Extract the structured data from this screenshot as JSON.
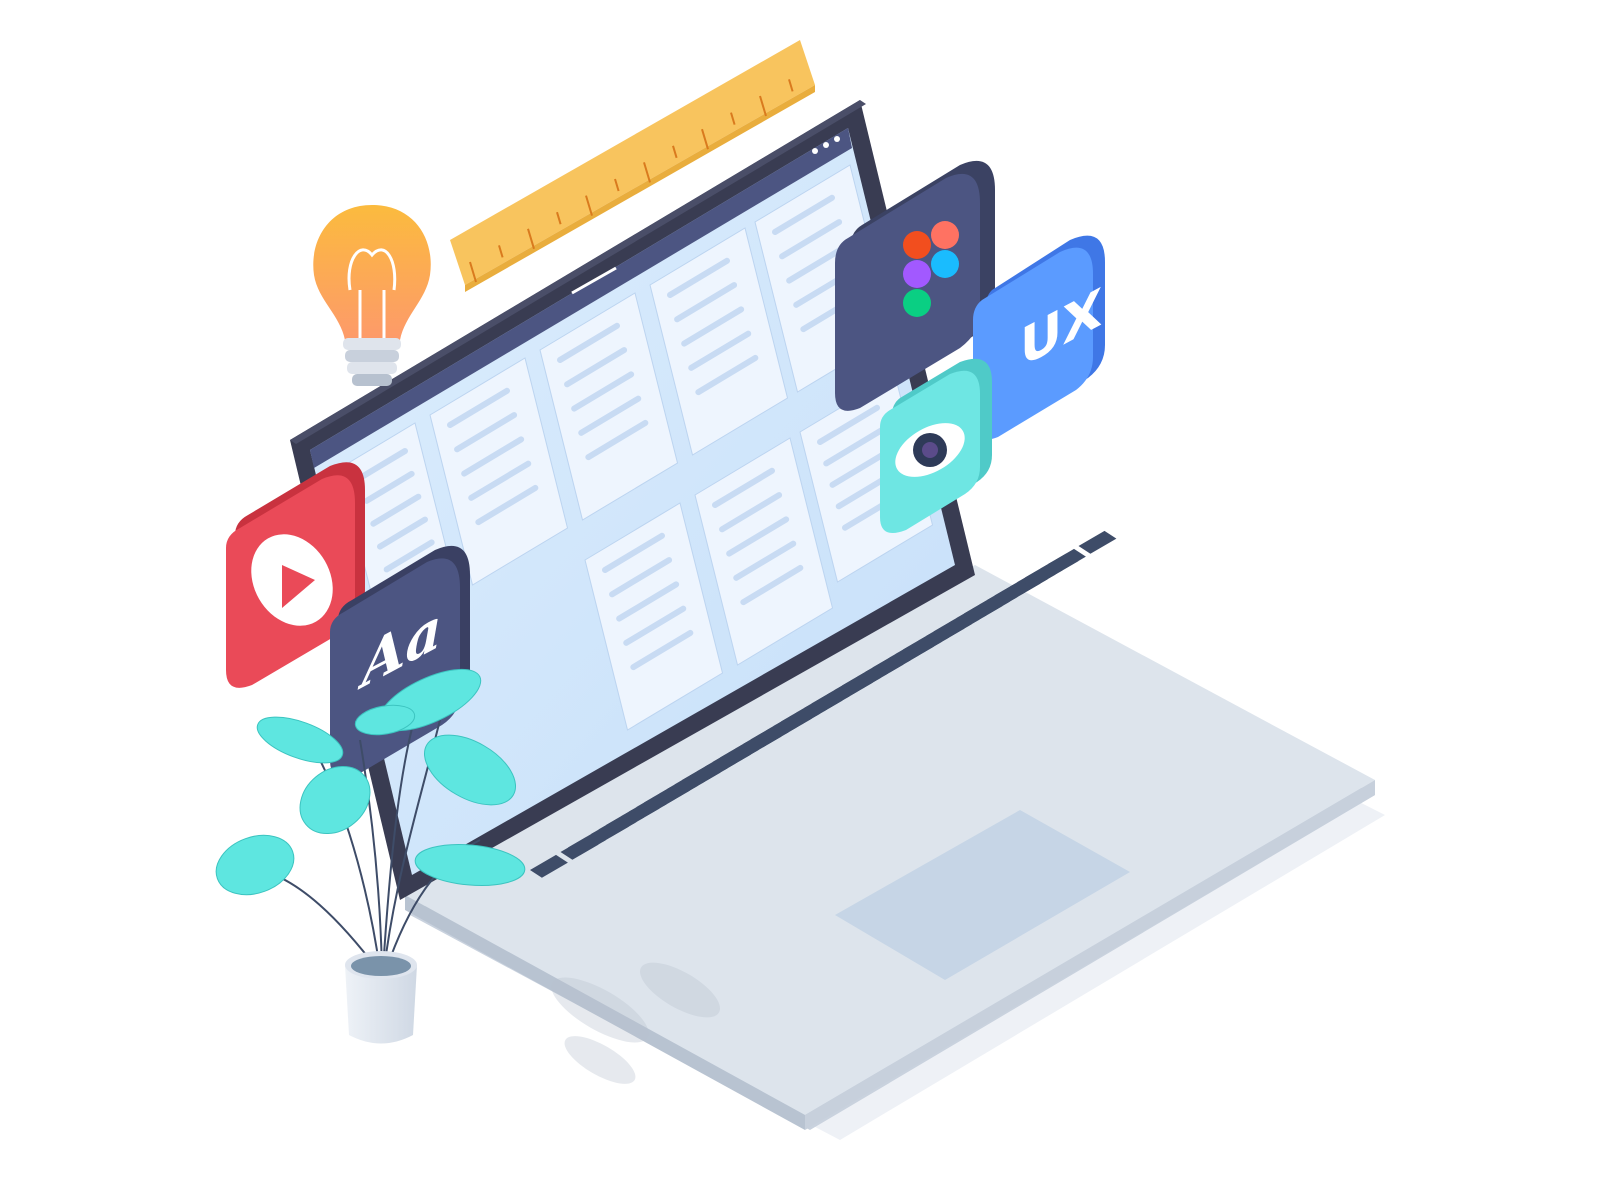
{
  "icons": {
    "ux_label": "UX",
    "type_label": "Aa"
  },
  "colors": {
    "screen_bezel": "#393c52",
    "screen_bg": "#cfe5fb",
    "keyboard_key": "#3e4c68",
    "laptop_body": "#d9e1ea",
    "figma_tile": "#4c5582",
    "ux_tile": "#4d8ffb",
    "eye_tile": "#5ee0de",
    "play_tile": "#e94a57",
    "type_tile": "#4c5582",
    "ruler": "#f8c45e",
    "bulb": "#fbbb3e",
    "plant_leaf": "#5ee6e0"
  }
}
